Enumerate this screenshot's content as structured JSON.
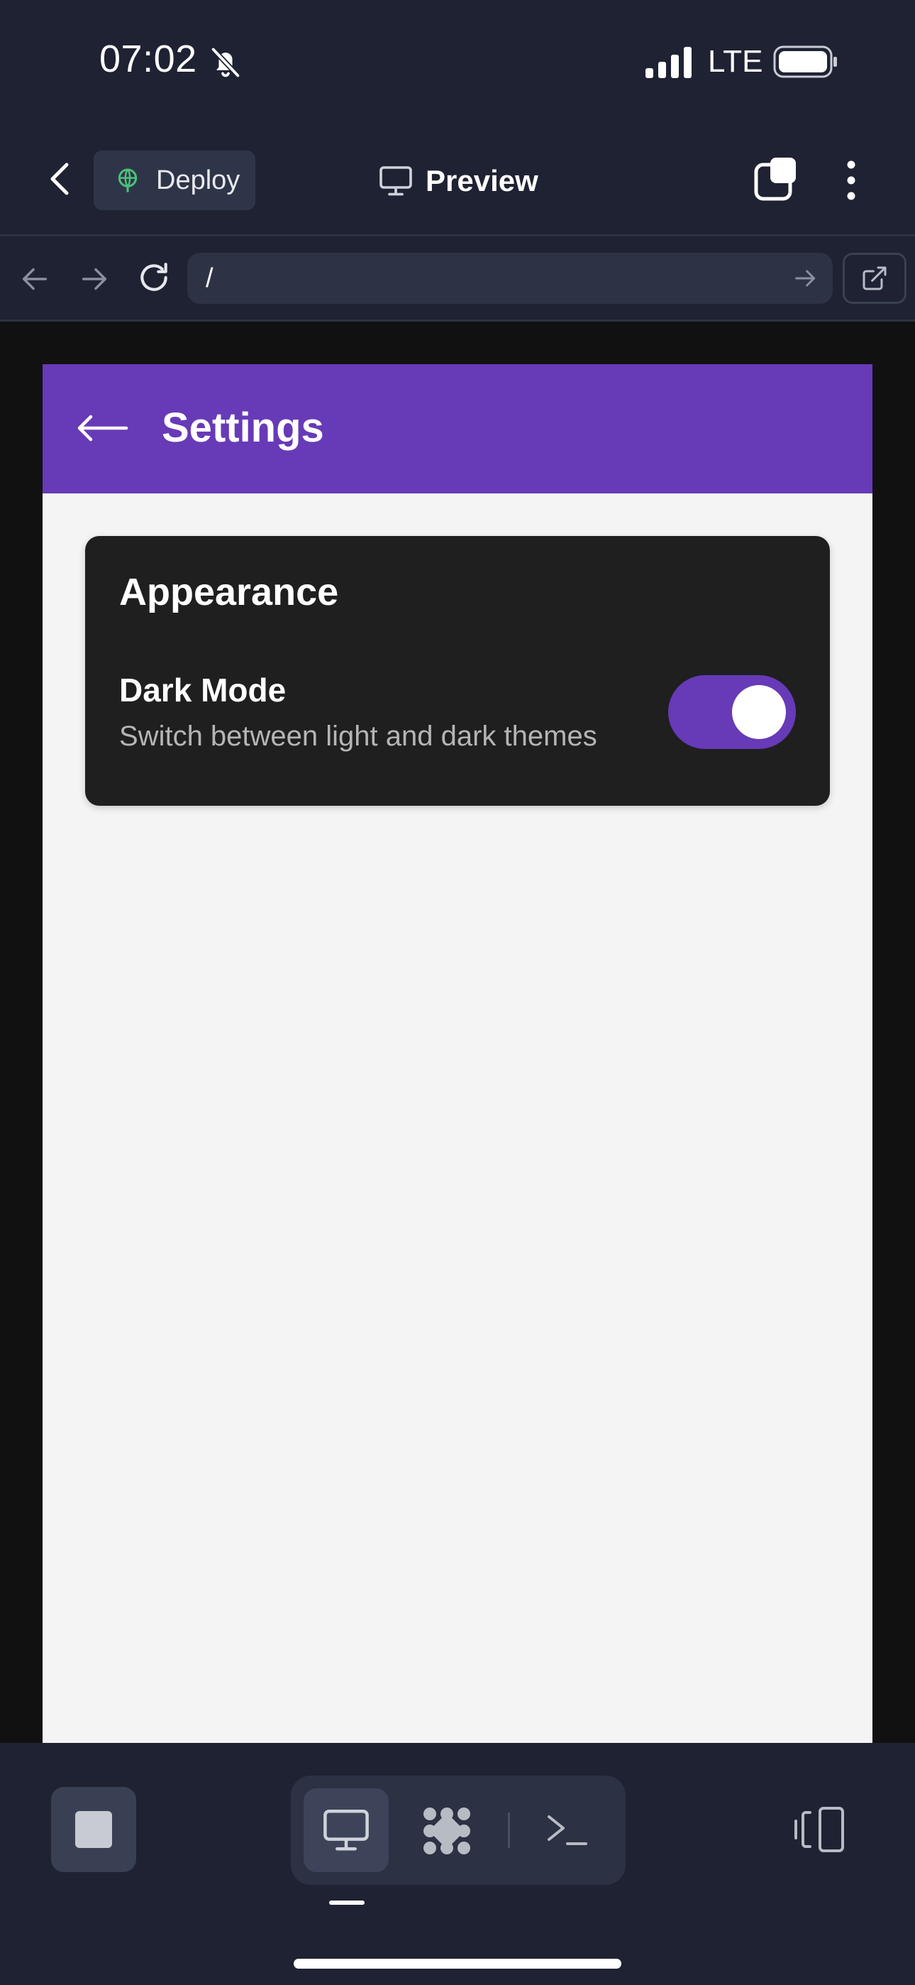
{
  "status_bar": {
    "time": "07:02",
    "network": "LTE",
    "icons": [
      "bell-off-icon",
      "signal-icon",
      "battery-icon"
    ]
  },
  "toolbar": {
    "deploy_label": "Deploy",
    "preview_label": "Preview",
    "icons": [
      "chevron-left-icon",
      "deploy-globe-icon",
      "monitor-icon",
      "tabs-icon",
      "more-vertical-icon"
    ]
  },
  "url_bar": {
    "path": "/",
    "icons": [
      "arrow-left-icon",
      "arrow-right-icon",
      "reload-icon",
      "arrow-right-small-icon",
      "external-link-icon"
    ]
  },
  "app": {
    "header": {
      "back_arrow": "⟵",
      "title": "Settings"
    },
    "card": {
      "title": "Appearance",
      "setting_label": "Dark Mode",
      "setting_description": "Switch between light and dark themes",
      "toggle_on": true
    }
  },
  "bottom_bar": {
    "icons": [
      "stop-icon",
      "monitor-icon",
      "agent-icon",
      "terminal-icon",
      "device-toggle-icon"
    ]
  },
  "colors": {
    "chrome_bg": "#1e2232",
    "accent_purple": "#673ab7",
    "card_bg": "#1f1f1f",
    "app_bg": "#f4f4f4",
    "deploy_green": "#4cc27a"
  }
}
